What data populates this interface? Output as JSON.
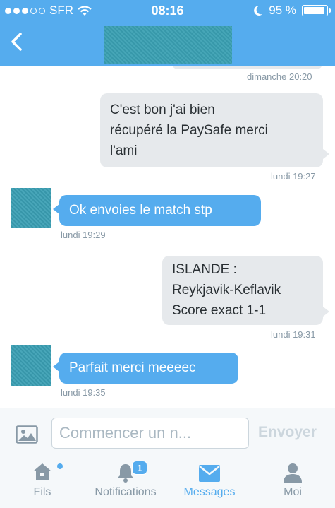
{
  "status_bar": {
    "carrier": "SFR",
    "time": "08:16",
    "battery": "95 %"
  },
  "header": {
    "back_icon": "chevron-left-icon",
    "title": ""
  },
  "messages": [
    {
      "direction": "out",
      "text": "",
      "time": "dimanche 20:20"
    },
    {
      "direction": "out",
      "text": "C'est bon j'ai bien\nrécupéré la PaySafe merci\nl'ami",
      "time": "lundi 19:27"
    },
    {
      "direction": "in",
      "text": "Ok envoies le match stp",
      "time": "lundi 19:29"
    },
    {
      "direction": "out",
      "text": "ISLANDE :\nReykjavik-Keflavik\nScore exact 1-1",
      "time": "lundi 19:31"
    },
    {
      "direction": "in",
      "text": "Parfait merci meeeec",
      "time": "lundi 19:35"
    }
  ],
  "composer": {
    "photo_icon": "image-icon",
    "placeholder": "Commencer un n...",
    "send_label": "Envoyer"
  },
  "tabbar": {
    "tabs": [
      {
        "label": "Fils",
        "icon": "home-icon"
      },
      {
        "label": "Notifications",
        "icon": "bell-icon",
        "badge": "1"
      },
      {
        "label": "Messages",
        "icon": "envelope-icon",
        "active": true
      },
      {
        "label": "Moi",
        "icon": "person-icon"
      }
    ]
  },
  "colors": {
    "accent": "#55acee",
    "outgoing_bubble": "#e6e9ec",
    "avatar": "#3a9fb4"
  }
}
